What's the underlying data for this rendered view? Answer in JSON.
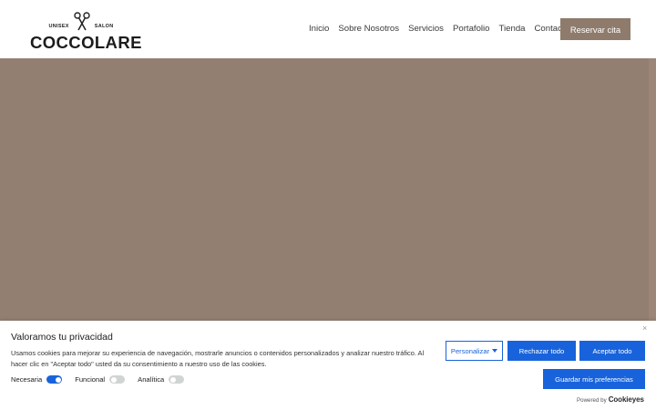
{
  "header": {
    "logo_small_left": "UNISEX",
    "logo_small_right": "SALON",
    "logo_name": "COCCOLARE",
    "nav": [
      "Inicio",
      "Sobre Nosotros",
      "Servicios",
      "Portafolio",
      "Tienda",
      "Contacto"
    ],
    "reserve_label": "Reservar cita"
  },
  "colors": {
    "brand": "#8e7b6b",
    "hero": "#937f72",
    "cookie_accent": "#1863dc"
  },
  "cookie": {
    "close": "×",
    "title": "Valoramos tu privacidad",
    "description": "Usamos cookies para mejorar su experiencia de navegación, mostrarle anuncios o contenidos personalizados y analizar nuestro tráfico. Al hacer clic en \"Aceptar todo\" usted da su consentimiento a nuestro uso de las cookies.",
    "toggles": [
      {
        "label": "Necesaria",
        "state": "on"
      },
      {
        "label": "Funcional",
        "state": "off"
      },
      {
        "label": "Analítica",
        "state": "off"
      }
    ],
    "customize_label": "Personalizar",
    "reject_label": "Rechazar todo",
    "accept_label": "Aceptar todo",
    "save_label": "Guardar mis preferencias",
    "powered_by": "Powered by",
    "powered_brand": "Cookieyes"
  }
}
